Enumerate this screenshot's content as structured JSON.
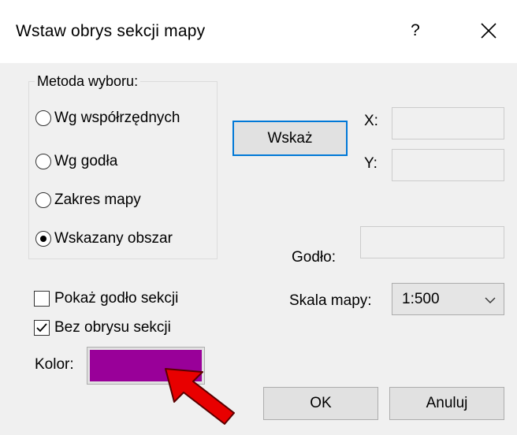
{
  "dialog": {
    "title": "Wstaw obrys sekcji mapy",
    "help_label": "?",
    "close_icon": "close-icon"
  },
  "method_group": {
    "legend": "Metoda wyboru:",
    "options": [
      {
        "label": "Wg współrzędnych",
        "checked": false
      },
      {
        "label": "Wg godła",
        "checked": false
      },
      {
        "label": "Zakres mapy",
        "checked": false
      },
      {
        "label": "Wskazany obszar",
        "checked": true
      }
    ]
  },
  "point": {
    "button_label": "Wskaż",
    "x_label": "X:",
    "x_value": "",
    "y_label": "Y:",
    "y_value": ""
  },
  "godlo": {
    "label": "Godło:",
    "value": ""
  },
  "scale": {
    "label": "Skala mapy:",
    "selected": "1:500",
    "icon": "chevron-down-icon"
  },
  "options": {
    "show_godlo_label": "Pokaż godło sekcji",
    "show_godlo_checked": false,
    "no_outline_label": "Bez obrysu sekcji",
    "no_outline_checked": true
  },
  "color": {
    "label": "Kolor:",
    "value": "#990099",
    "pointer_color": "#ff0000"
  },
  "buttons": {
    "ok_label": "OK",
    "cancel_label": "Anuluj"
  }
}
